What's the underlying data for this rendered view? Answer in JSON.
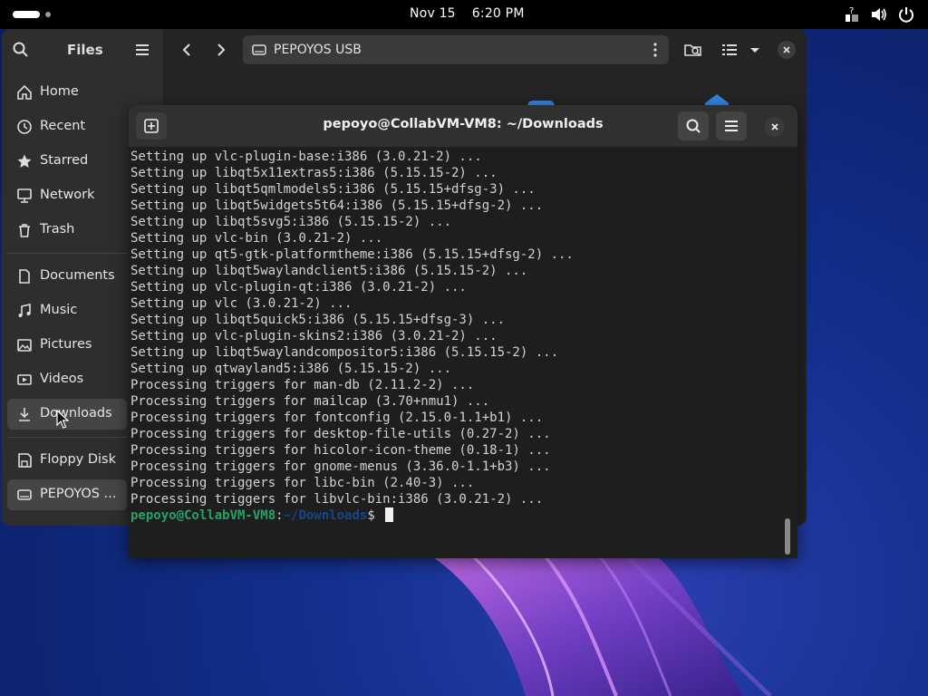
{
  "topbar": {
    "date": "Nov 15",
    "time": "6:20 PM",
    "icons": [
      "activities-indicator",
      "accessibility-icon",
      "volume-icon",
      "power-icon"
    ]
  },
  "files": {
    "title": "Files",
    "path_label": "PEPOYOS USB",
    "sidebar": {
      "places": [
        {
          "label": "Home",
          "icon": "home-icon"
        },
        {
          "label": "Recent",
          "icon": "recent-icon"
        },
        {
          "label": "Starred",
          "icon": "star-icon"
        },
        {
          "label": "Network",
          "icon": "network-icon"
        },
        {
          "label": "Trash",
          "icon": "trash-icon"
        }
      ],
      "bookmarks": [
        {
          "label": "Documents",
          "icon": "documents-icon"
        },
        {
          "label": "Music",
          "icon": "music-icon"
        },
        {
          "label": "Pictures",
          "icon": "pictures-icon"
        },
        {
          "label": "Videos",
          "icon": "videos-icon"
        },
        {
          "label": "Downloads",
          "icon": "downloads-icon"
        }
      ],
      "devices": [
        {
          "label": "Floppy Disk",
          "icon": "floppy-icon"
        },
        {
          "label": "PEPOYOS ...",
          "icon": "drive-icon"
        }
      ]
    }
  },
  "terminal": {
    "title": "pepoyo@CollabVM-VM8: ~/Downloads",
    "lines": [
      "Setting up vlc-plugin-base:i386 (3.0.21-2) ...",
      "Setting up libqt5x11extras5:i386 (5.15.15-2) ...",
      "Setting up libqt5qmlmodels5:i386 (5.15.15+dfsg-3) ...",
      "Setting up libqt5widgets5t64:i386 (5.15.15+dfsg-2) ...",
      "Setting up libqt5svg5:i386 (5.15.15-2) ...",
      "Setting up vlc-bin (3.0.21-2) ...",
      "Setting up qt5-gtk-platformtheme:i386 (5.15.15+dfsg-2) ...",
      "Setting up libqt5waylandclient5:i386 (5.15.15-2) ...",
      "Setting up vlc-plugin-qt:i386 (3.0.21-2) ...",
      "Setting up vlc (3.0.21-2) ...",
      "Setting up libqt5quick5:i386 (5.15.15+dfsg-3) ...",
      "Setting up vlc-plugin-skins2:i386 (3.0.21-2) ...",
      "Setting up libqt5waylandcompositor5:i386 (5.15.15-2) ...",
      "Setting up qtwayland5:i386 (5.15.15-2) ...",
      "Processing triggers for man-db (2.11.2-2) ...",
      "Processing triggers for mailcap (3.70+nmu1) ...",
      "Processing triggers for fontconfig (2.15.0-1.1+b1) ...",
      "Processing triggers for desktop-file-utils (0.27-2) ...",
      "Processing triggers for hicolor-icon-theme (0.18-1) ...",
      "Processing triggers for gnome-menus (3.36.0-1.1+b3) ...",
      "Processing triggers for libc-bin (2.40-3) ...",
      "Processing triggers for libvlc-bin:i386 (3.0.21-2) ..."
    ],
    "prompt": {
      "user_host": "pepoyo@CollabVM-VM8",
      "separator": ":",
      "path": "~/Downloads",
      "symbol": "$ "
    }
  },
  "colors": {
    "prompt_user": "#26a269",
    "prompt_path": "#12488b",
    "accent": "#3584e4"
  }
}
